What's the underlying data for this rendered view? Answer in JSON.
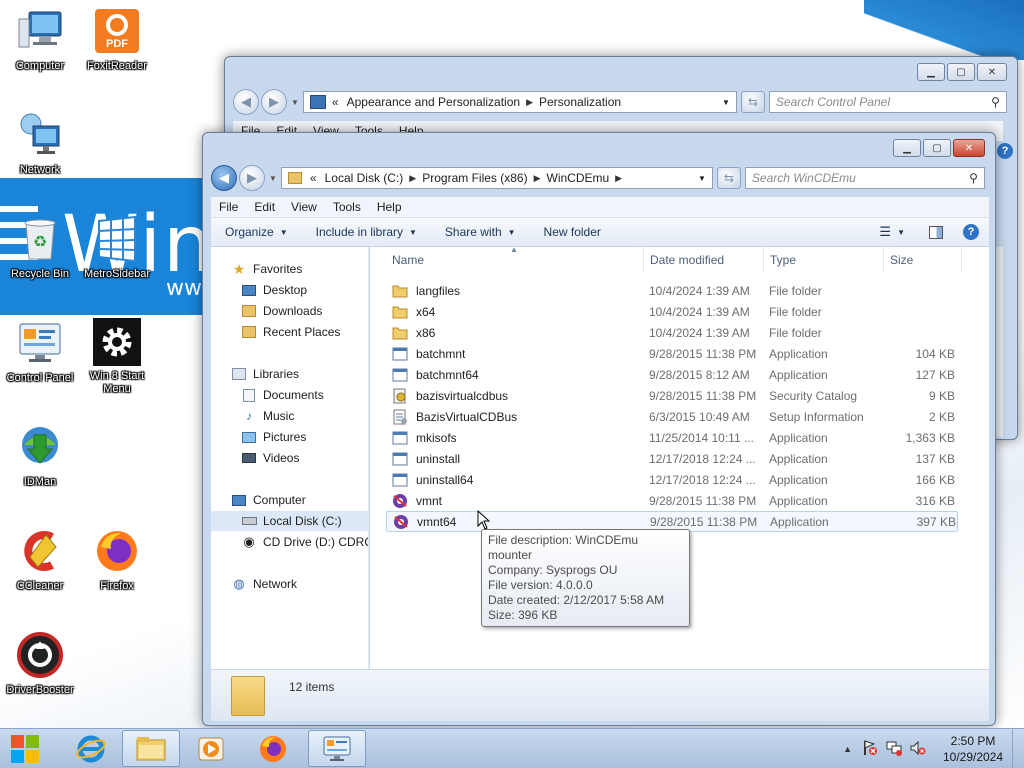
{
  "desktop": {
    "wallpaper_text": "Wind",
    "wallpaper_url_fragment": "www",
    "icons": [
      {
        "label": "Computer",
        "icon": "computer-icon"
      },
      {
        "label": "FoxitReader",
        "icon": "pdf-icon",
        "badge": "PDF"
      },
      {
        "label": "Network",
        "icon": "network-icon"
      },
      {
        "label": "Recycle Bin",
        "icon": "recycle-bin-icon"
      },
      {
        "label": "MetroSidebar",
        "icon": "metro-sidebar-icon"
      },
      {
        "label": "Control Panel",
        "icon": "control-panel-icon"
      },
      {
        "label": "Win 8 Start Menu",
        "icon": "gear-icon"
      },
      {
        "label": "IDMan",
        "icon": "idman-icon"
      },
      {
        "label": "CCleaner",
        "icon": "ccleaner-icon"
      },
      {
        "label": "Firefox",
        "icon": "firefox-icon"
      },
      {
        "label": "DriverBooster",
        "icon": "driverbooster-icon"
      }
    ]
  },
  "bg_window": {
    "breadcrumb_prefix": "«",
    "breadcrumb": [
      "Appearance and Personalization",
      "Personalization"
    ],
    "search_placeholder": "Search Control Panel",
    "menu": [
      "File",
      "Edit",
      "View",
      "Tools",
      "Help"
    ]
  },
  "explorer": {
    "breadcrumb_prefix": "«",
    "breadcrumb": [
      "Local Disk (C:)",
      "Program Files (x86)",
      "WinCDEmu"
    ],
    "search_placeholder": "Search WinCDEmu",
    "menu": [
      "File",
      "Edit",
      "View",
      "Tools",
      "Help"
    ],
    "commands": [
      "Organize",
      "Include in library",
      "Share with",
      "New folder"
    ],
    "columns": [
      "Name",
      "Date modified",
      "Type",
      "Size"
    ],
    "nav": {
      "favorites_header": "Favorites",
      "favorites": [
        "Desktop",
        "Downloads",
        "Recent Places"
      ],
      "libraries_header": "Libraries",
      "libraries": [
        "Documents",
        "Music",
        "Pictures",
        "Videos"
      ],
      "computer_header": "Computer",
      "computer": [
        "Local Disk (C:)",
        "CD Drive (D:) CDROM"
      ],
      "network_header": "Network"
    },
    "files": [
      {
        "name": "langfiles",
        "date": "10/4/2024 1:39 AM",
        "type": "File folder",
        "size": "",
        "icon": "folder-icon"
      },
      {
        "name": "x64",
        "date": "10/4/2024 1:39 AM",
        "type": "File folder",
        "size": "",
        "icon": "folder-icon"
      },
      {
        "name": "x86",
        "date": "10/4/2024 1:39 AM",
        "type": "File folder",
        "size": "",
        "icon": "folder-icon"
      },
      {
        "name": "batchmnt",
        "date": "9/28/2015 11:38 PM",
        "type": "Application",
        "size": "104 KB",
        "icon": "application-icon"
      },
      {
        "name": "batchmnt64",
        "date": "9/28/2015 8:12 AM",
        "type": "Application",
        "size": "127 KB",
        "icon": "application-icon"
      },
      {
        "name": "bazisvirtualcdbus",
        "date": "9/28/2015 11:38 PM",
        "type": "Security Catalog",
        "size": "9 KB",
        "icon": "security-catalog-icon"
      },
      {
        "name": "BazisVirtualCDBus",
        "date": "6/3/2015 10:49 AM",
        "type": "Setup Information",
        "size": "2 KB",
        "icon": "setup-info-icon"
      },
      {
        "name": "mkisofs",
        "date": "11/25/2014 10:11 ...",
        "type": "Application",
        "size": "1,363 KB",
        "icon": "application-icon"
      },
      {
        "name": "uninstall",
        "date": "12/17/2018 12:24 ...",
        "type": "Application",
        "size": "137 KB",
        "icon": "application-icon"
      },
      {
        "name": "uninstall64",
        "date": "12/17/2018 12:24 ...",
        "type": "Application",
        "size": "166 KB",
        "icon": "application-icon"
      },
      {
        "name": "vmnt",
        "date": "9/28/2015 11:38 PM",
        "type": "Application",
        "size": "316 KB",
        "icon": "vmnt-icon"
      },
      {
        "name": "vmnt64",
        "date": "9/28/2015 11:38 PM",
        "type": "Application",
        "size": "397 KB",
        "icon": "vmnt-icon"
      }
    ],
    "tooltip": [
      "File description: WinCDEmu mounter",
      "Company: Sysprogs OU",
      "File version: 4.0.0.0",
      "Date created: 2/12/2017 5:58 AM",
      "Size: 396 KB"
    ],
    "status_items": "12 items"
  },
  "taskbar": {
    "time": "2:50 PM",
    "date": "10/29/2024"
  },
  "colors": {
    "accent": "#1a84d8",
    "selection": "#dce8f7",
    "taskbar": "#b9cce4"
  }
}
